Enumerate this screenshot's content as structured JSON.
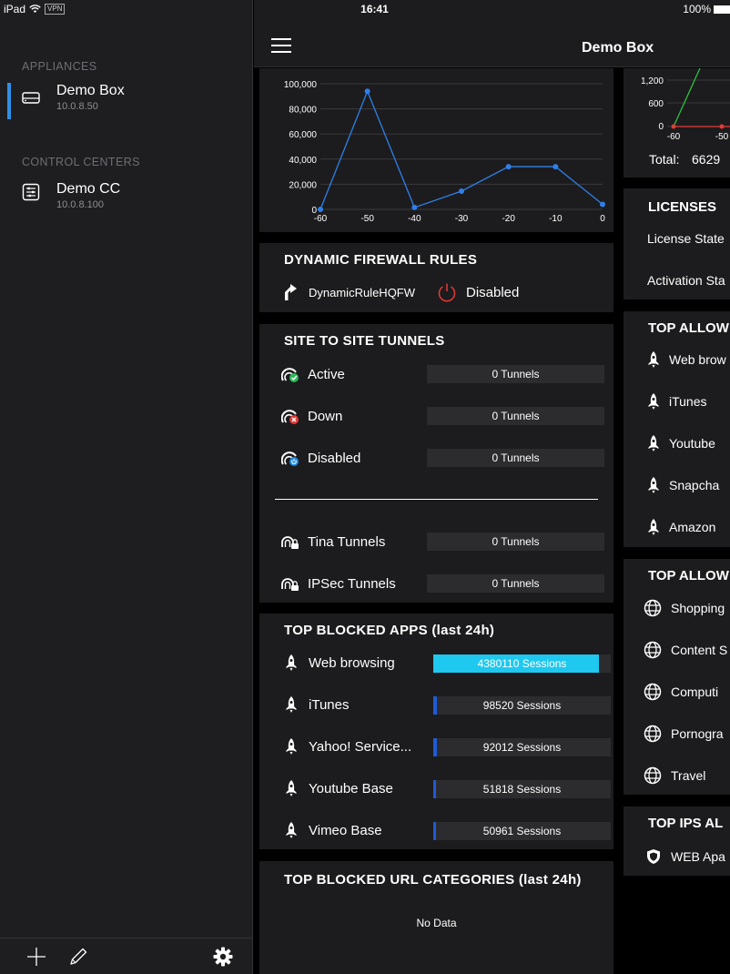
{
  "status": {
    "device": "iPad",
    "vpn": "VPN",
    "time": "16:41",
    "battery": "100%"
  },
  "sidebar": {
    "appliances_header": "APPLIANCES",
    "appliances": [
      {
        "name": "Demo Box",
        "ip": "10.0.8.50",
        "selected": true
      }
    ],
    "control_centers_header": "CONTROL CENTERS",
    "control_centers": [
      {
        "name": "Demo CC",
        "ip": "10.0.8.100"
      }
    ],
    "bottom_icons": [
      "plus-icon",
      "pencil-icon",
      "gear-icon"
    ]
  },
  "nav": {
    "title": "Demo Box",
    "menu_icon": "hamburger-icon"
  },
  "chart_data": {
    "type": "line",
    "x": [
      -60,
      -50,
      -40,
      -30,
      -20,
      -10,
      0
    ],
    "y_ticks": [
      "0",
      "20,000",
      "40,000",
      "60,000",
      "80,000",
      "100,000"
    ],
    "x_ticks": [
      "-60",
      "-50",
      "-40",
      "-30",
      "-20",
      "-10",
      "0"
    ],
    "series": [
      {
        "values": [
          0,
          94000,
          1500,
          14500,
          34000,
          34000,
          4000
        ],
        "color": "#2f7fe8"
      }
    ],
    "ylim": [
      0,
      100000
    ],
    "xlim": [
      -60,
      0
    ],
    "grid": true
  },
  "firewall": {
    "title": "DYNAMIC FIREWALL RULES",
    "rule_name": "DynamicRuleHQFW",
    "rule_state": "Disabled"
  },
  "tunnels": {
    "title": "SITE TO SITE TUNNELS",
    "rows": [
      {
        "label": "Active",
        "value": "0 Tunnels",
        "icon": "tunnel-active-icon"
      },
      {
        "label": "Down",
        "value": "0 Tunnels",
        "icon": "tunnel-down-icon"
      },
      {
        "label": "Disabled",
        "value": "0 Tunnels",
        "icon": "tunnel-disabled-icon"
      },
      {
        "label": "Tina Tunnels",
        "value": "0 Tunnels",
        "icon": "tina-tunnel-icon"
      },
      {
        "label": "IPSec Tunnels",
        "value": "0 Tunnels",
        "icon": "ipsec-tunnel-icon"
      }
    ]
  },
  "blocked_apps": {
    "title": "TOP BLOCKED APPS (last 24h)",
    "rows": [
      {
        "label": "Web browsing",
        "value": "4380110 Sessions",
        "fraction": 0.935
      },
      {
        "label": "iTunes",
        "value": "98520 Sessions",
        "fraction": 0.021
      },
      {
        "label": "Yahoo! Service...",
        "value": "92012 Sessions",
        "fraction": 0.02
      },
      {
        "label": "Youtube Base",
        "value": "51818 Sessions",
        "fraction": 0.012
      },
      {
        "label": "Vimeo Base",
        "value": "50961 Sessions",
        "fraction": 0.012
      }
    ]
  },
  "blocked_urls": {
    "title": "TOP BLOCKED URL CATEGORIES (last 24h)",
    "empty": "No Data"
  },
  "right_column": {
    "mini_chart": {
      "y_ticks": [
        "1,200",
        "600",
        "0"
      ],
      "x_ticks": [
        "-60",
        "-50"
      ],
      "total_label": "Total:",
      "total_value": "6629"
    },
    "licenses": {
      "title": "LICENSES",
      "rows": [
        "License State",
        "Activation Sta"
      ]
    },
    "top_allowed_apps": {
      "title": "TOP ALLOW",
      "rows": [
        "Web brow",
        "iTunes",
        "Youtube",
        "Snapcha",
        "Amazon"
      ]
    },
    "top_allowed_urls": {
      "title": "TOP ALLOW",
      "rows": [
        "Shopping",
        "Content S",
        "Computi",
        "Pornogra",
        "Travel"
      ]
    },
    "top_ips": {
      "title": "TOP IPS AL",
      "rows": [
        "WEB Apa"
      ]
    }
  }
}
